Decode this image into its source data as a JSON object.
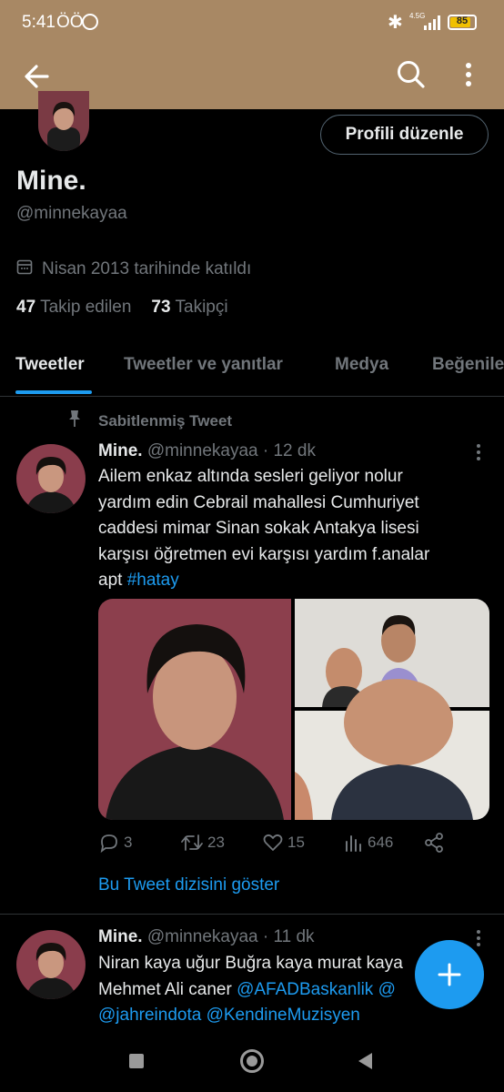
{
  "status_bar": {
    "time": "5:41",
    "notif_icons": "ÖÖ",
    "network": "4.5G",
    "battery": "85",
    "battery_level": 0.85,
    "battery_color": "#f0c000"
  },
  "app_bar": {
    "background": "#a88864",
    "icons": [
      "arrow-left-icon",
      "search-icon",
      "more-vertical-icon"
    ]
  },
  "profile": {
    "edit_button": "Profili düzenle",
    "name": "Mine.",
    "handle": "@minnekayaa",
    "joined": "Nisan 2013 tarihinde katıldı",
    "following_count": "47",
    "following_label": "Takip edilen",
    "followers_count": "73",
    "followers_label": "Takipçi"
  },
  "tabs": [
    {
      "label": "Tweetler",
      "active": true
    },
    {
      "label": "Tweetler ve yanıtlar",
      "active": false
    },
    {
      "label": "Medya",
      "active": false
    },
    {
      "label": "Beğenile",
      "active": false
    }
  ],
  "pinned_tweet": {
    "pinned_label": "Sabitlenmiş Tweet",
    "author": "Mine.",
    "handle": "@minnekayaa",
    "time": "· 12 dk",
    "text_lines": [
      "Ailem enkaz altında sesleri geliyor nolur",
      "yardım edin Cebrail mahallesi Cumhuriyet",
      "caddesi mimar Sinan sokak Antakya lisesi",
      "karşısı öğretmen evi karşısı yardım f.analar"
    ],
    "text_last": "apt ",
    "hashtag": "#hatay",
    "replies": "3",
    "retweets": "23",
    "likes": "15",
    "views": "646",
    "thread_link": "Bu Tweet dizisini göster"
  },
  "second_tweet": {
    "author": "Mine.",
    "handle": "@minnekayaa",
    "time": "· 11 dk",
    "line1": "Niran kaya uğur Buğra kaya murat kaya",
    "line2_text": "Mehmet Ali caner ",
    "line2_mention": "@AFADBaskanlik @",
    "line3_mention1": "@jahreindota",
    "line3_mention2": "@KendineMuzisyen"
  },
  "colors": {
    "accent": "#1d9bf0",
    "secondary_text": "#71767b",
    "divider": "#2f3336"
  }
}
